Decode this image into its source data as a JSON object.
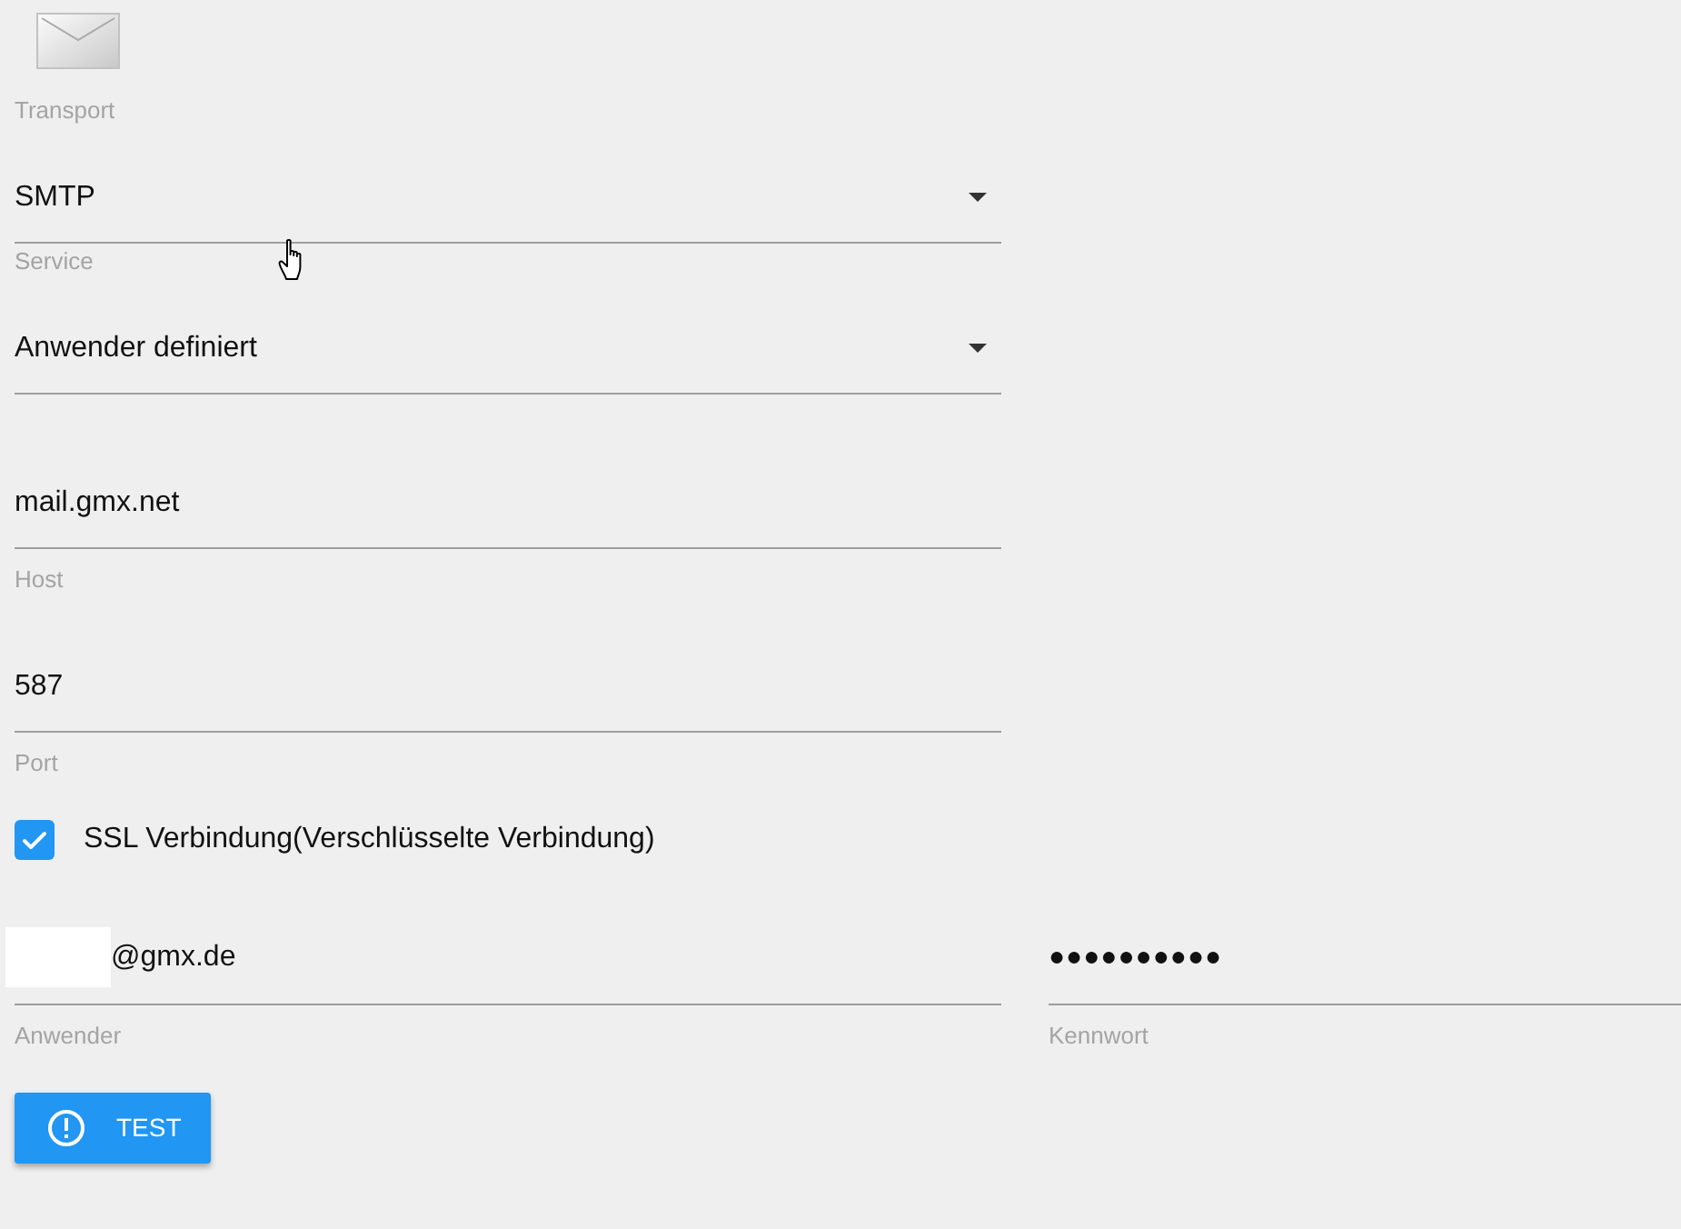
{
  "fields": [
    {
      "kind": "select",
      "label": "Transport",
      "value": "SMTP"
    },
    {
      "kind": "select",
      "label": "Service",
      "value": "Anwender definiert"
    },
    {
      "kind": "text",
      "value": "mail.gmx.net",
      "helper": "Host"
    },
    {
      "kind": "text",
      "value": "587",
      "helper": "Port"
    },
    {
      "kind": "checkbox",
      "label": "SSL Verbindung(Verschlüsselte Verbindung)",
      "checked": true
    }
  ],
  "credentials": [
    {
      "kind": "text",
      "redacted": true,
      "value": "@gmx.de",
      "helper": "Anwender"
    },
    {
      "kind": "password",
      "value": "●●●●●●●●●●",
      "helper": "Kennwort"
    }
  ],
  "buttons": [
    {
      "label": "TEST"
    }
  ]
}
